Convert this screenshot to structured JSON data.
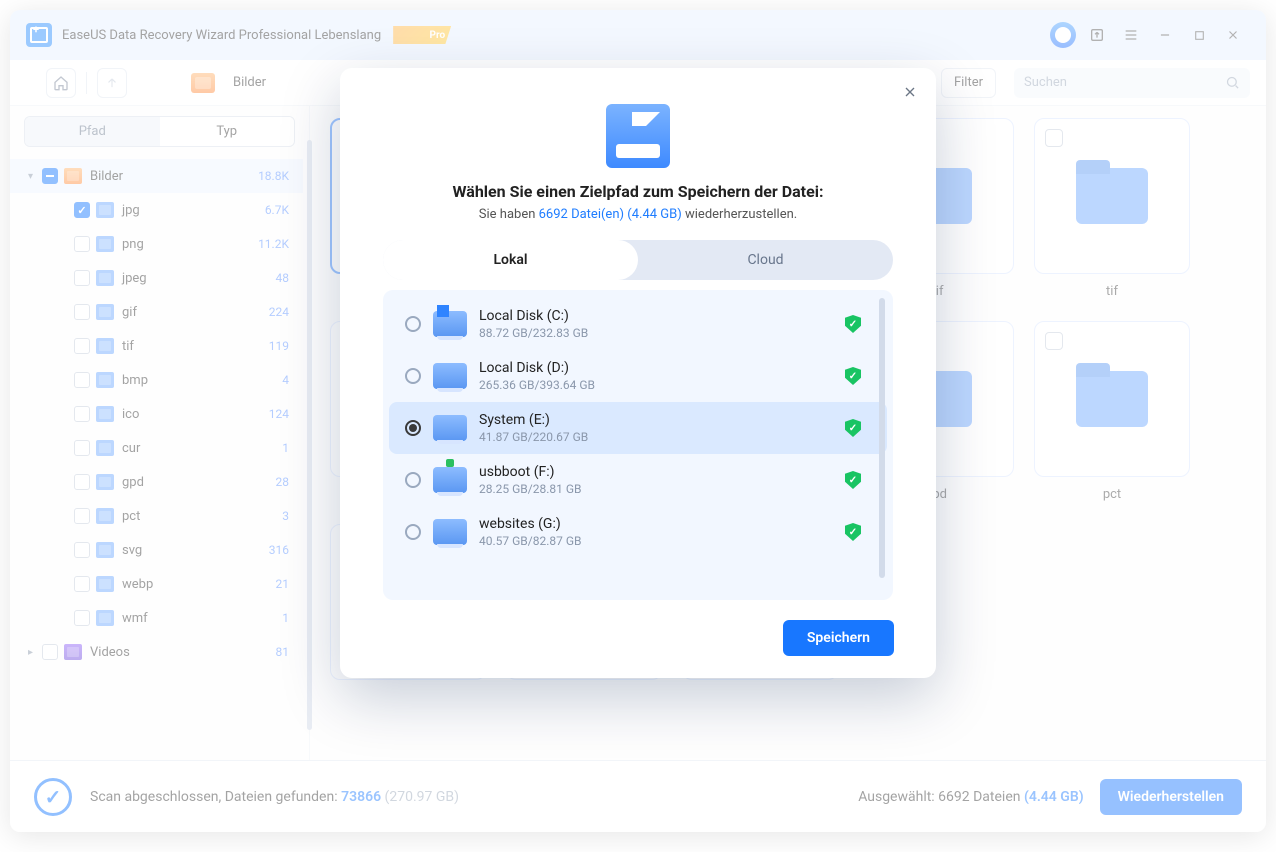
{
  "titlebar": {
    "title": "EaseUS Data Recovery Wizard Professional Lebenslang",
    "pro": "Pro"
  },
  "toolbar": {
    "home_icon": "home",
    "up_icon": "up",
    "crumb": "Bilder",
    "filter_label": "Filter",
    "search_placeholder": "Suchen"
  },
  "sidebar": {
    "seg_left": "Pfad",
    "seg_right": "Typ",
    "nodes": [
      {
        "label": "Bilder",
        "count": "18.8K",
        "checked": "indet",
        "icon": "orange",
        "expandable": true
      },
      {
        "label": "jpg",
        "count": "6.7K",
        "checked": "checked"
      },
      {
        "label": "png",
        "count": "11.2K",
        "checked": ""
      },
      {
        "label": "jpeg",
        "count": "48",
        "checked": ""
      },
      {
        "label": "gif",
        "count": "224",
        "checked": ""
      },
      {
        "label": "tif",
        "count": "119",
        "checked": ""
      },
      {
        "label": "bmp",
        "count": "4",
        "checked": ""
      },
      {
        "label": "ico",
        "count": "124",
        "checked": ""
      },
      {
        "label": "cur",
        "count": "1",
        "checked": ""
      },
      {
        "label": "gpd",
        "count": "28",
        "checked": ""
      },
      {
        "label": "pct",
        "count": "3",
        "checked": ""
      },
      {
        "label": "svg",
        "count": "316",
        "checked": ""
      },
      {
        "label": "webp",
        "count": "21",
        "checked": ""
      },
      {
        "label": "wmf",
        "count": "1",
        "checked": ""
      },
      {
        "label": "Videos",
        "count": "81",
        "checked": "",
        "icon": "purple",
        "expandable": true
      }
    ]
  },
  "grid": {
    "row1": [
      {
        "caption": "",
        "state": "checked"
      },
      {
        "caption": "",
        "state": ""
      },
      {
        "caption": "",
        "state": ""
      },
      {
        "caption": "gif",
        "state": ""
      },
      {
        "caption": "tif",
        "state": ""
      }
    ],
    "row2": [
      {
        "caption": "",
        "state": "indet"
      },
      {
        "caption": "",
        "state": ""
      },
      {
        "caption": "",
        "state": ""
      },
      {
        "caption": "gpd",
        "state": ""
      },
      {
        "caption": "pct",
        "state": ""
      }
    ],
    "row3": [
      {
        "caption": "",
        "state": ""
      },
      {
        "caption": "",
        "state": ""
      },
      {
        "caption": "",
        "state": ""
      }
    ]
  },
  "status": {
    "label_a": "Scan abgeschlossen, Dateien gefunden: ",
    "count": "73866",
    "size": " (270.97 GB)",
    "selected_label": "Ausgewählt: 6692 Dateien ",
    "selected_size": "(4.44 GB)",
    "recover_btn": "Wiederherstellen"
  },
  "modal": {
    "title": "Wählen Sie einen Zielpfad zum Speichern der Datei:",
    "sub_a": "Sie haben ",
    "sub_b": "6692 Datei(en) (4.44 GB)",
    "sub_c": " wiederherzustellen.",
    "tab_local": "Lokal",
    "tab_cloud": "Cloud",
    "disks": [
      {
        "name": "Local Disk (C:)",
        "size": "88.72 GB/232.83 GB",
        "sel": false,
        "kind": "os"
      },
      {
        "name": "Local Disk (D:)",
        "size": "265.36 GB/393.64 GB",
        "sel": false,
        "kind": ""
      },
      {
        "name": "System (E:)",
        "size": "41.87 GB/220.67 GB",
        "sel": true,
        "kind": ""
      },
      {
        "name": "usbboot (F:)",
        "size": "28.25 GB/28.81 GB",
        "sel": false,
        "kind": "usb"
      },
      {
        "name": "websites (G:)",
        "size": "40.57 GB/82.87 GB",
        "sel": false,
        "kind": ""
      }
    ],
    "save_btn": "Speichern"
  }
}
